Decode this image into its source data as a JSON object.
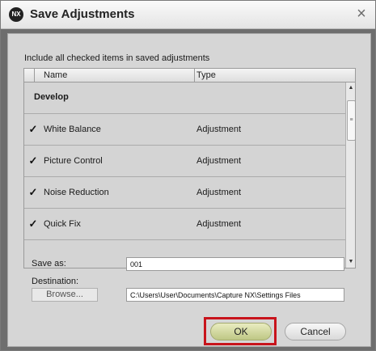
{
  "window": {
    "title": "Save Adjustments",
    "app_icon_text": "NX",
    "close_glyph": "×"
  },
  "instruction": "Include all checked items in saved adjustments",
  "list": {
    "columns": {
      "name": "Name",
      "type": "Type"
    },
    "group": "Develop",
    "rows": [
      {
        "name": "White Balance",
        "type": "Adjustment",
        "checked": true
      },
      {
        "name": "Picture Control",
        "type": "Adjustment",
        "checked": true
      },
      {
        "name": "Noise Reduction",
        "type": "Adjustment",
        "checked": true
      },
      {
        "name": "Quick Fix",
        "type": "Adjustment",
        "checked": true
      }
    ],
    "check_glyph": "✓",
    "scroll_up_glyph": "▲",
    "scroll_down_glyph": "▼",
    "scroll_thumb_glyph": "≡"
  },
  "save_as": {
    "label": "Save as:",
    "value": "001"
  },
  "destination": {
    "label": "Destination:",
    "browse_label": "Browse...",
    "path": "C:\\Users\\User\\Documents\\Capture NX\\Settings Files"
  },
  "buttons": {
    "ok": "OK",
    "cancel": "Cancel"
  },
  "colors": {
    "highlight_outline": "#c8141c",
    "ok_button": "#d8dca0"
  }
}
